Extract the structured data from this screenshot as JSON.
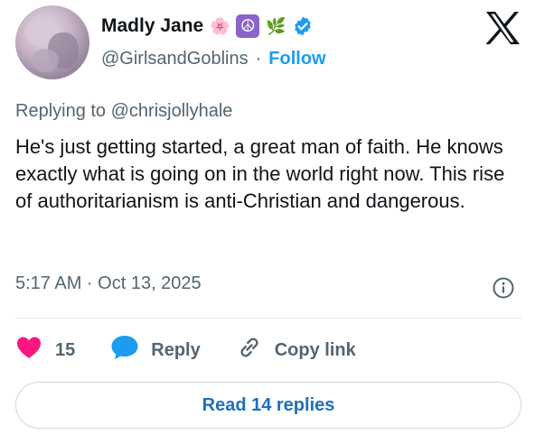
{
  "author": {
    "name": "Madly Jane",
    "emojis": [
      "🌸",
      "☮",
      "🌿"
    ],
    "handle": "@GirlsandGoblins",
    "separator": "·",
    "follow_label": "Follow"
  },
  "tweet": {
    "replying_to": "Replying to @chrisjollyhale",
    "text": "He's just getting started, a great man of faith. He knows exactly what is going on in the world right now. This rise of authoritarianism is anti-Christian and dangerous.",
    "timestamp": "5:17 AM · Oct 13, 2025"
  },
  "actions": {
    "like_count": "15",
    "reply_label": "Reply",
    "copy_link_label": "Copy link"
  },
  "read_replies_label": "Read 14 replies",
  "icons": {
    "verified": "verified-badge-icon",
    "logo": "x-logo-icon",
    "info": "info-icon",
    "heart": "heart-icon",
    "reply": "speech-bubble-icon",
    "link": "link-icon"
  },
  "colors": {
    "accent": "#1d9bf0",
    "heart": "#f91880",
    "muted": "#536471"
  }
}
